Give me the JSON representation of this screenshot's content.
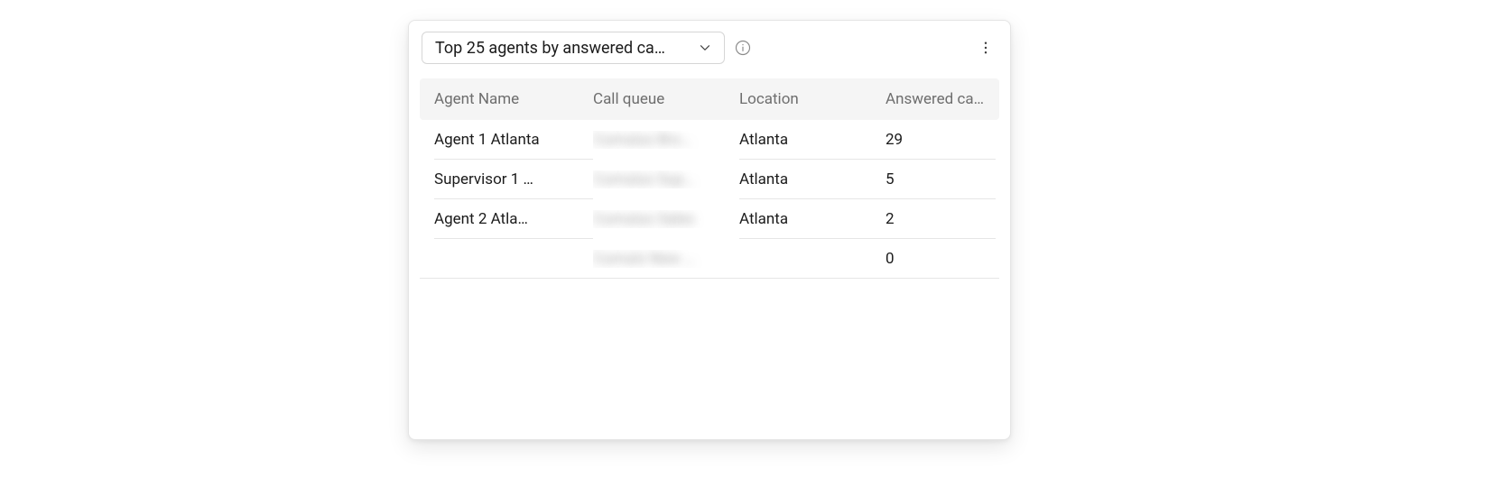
{
  "header": {
    "dropdown_label": "Top 25 agents by answered ca…"
  },
  "table": {
    "columns": [
      "Agent Name",
      "Call queue",
      "Location",
      "Answered ca…"
    ],
    "rows": [
      {
        "agent_name": "Agent 1 Atlanta",
        "call_queue": "Cumulus Bro…",
        "location": "Atlanta",
        "answered": "29",
        "queue_blurred": true,
        "agent_empty": false,
        "location_empty": false
      },
      {
        "agent_name": "Supervisor 1 …",
        "call_queue": "Cumulus Sup…",
        "location": "Atlanta",
        "answered": "5",
        "queue_blurred": true,
        "agent_empty": false,
        "location_empty": false
      },
      {
        "agent_name": "Agent 2 Atla…",
        "call_queue": "Cumulus Sales",
        "location": "Atlanta",
        "answered": "2",
        "queue_blurred": true,
        "agent_empty": false,
        "location_empty": false
      },
      {
        "agent_name": "",
        "call_queue": "Cumulo New …",
        "location": "",
        "answered": "0",
        "queue_blurred": true,
        "agent_empty": true,
        "location_empty": true
      }
    ]
  }
}
